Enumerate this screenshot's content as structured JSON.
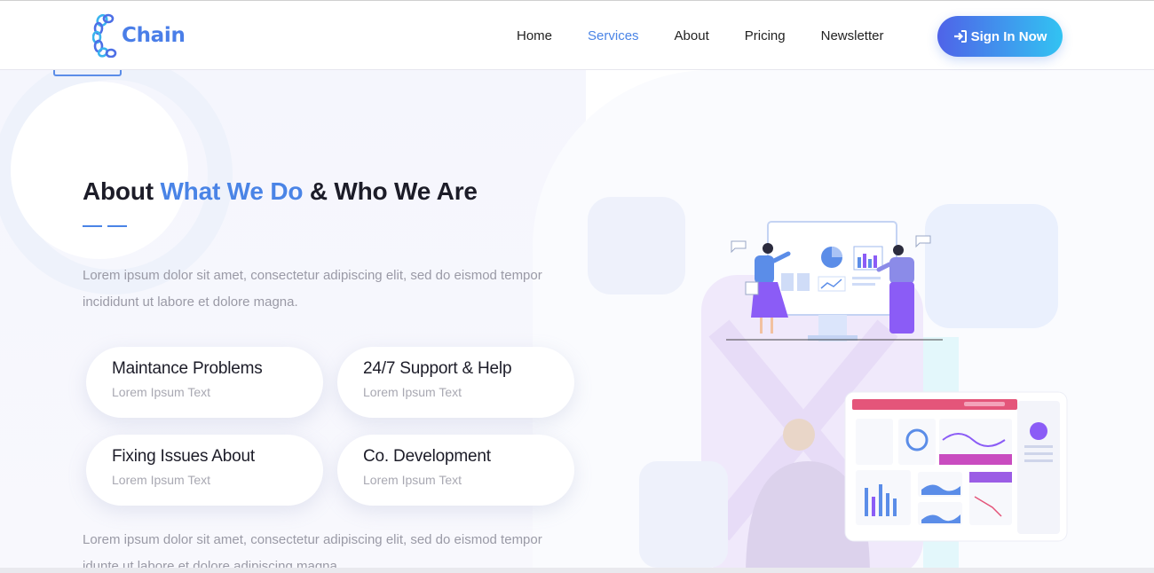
{
  "brand": {
    "name": "Chain",
    "accent": "#4a7ee8"
  },
  "nav": {
    "items": [
      {
        "label": "Home",
        "active": false
      },
      {
        "label": "Services",
        "active": true
      },
      {
        "label": "About",
        "active": false
      },
      {
        "label": "Pricing",
        "active": false
      },
      {
        "label": "Newsletter",
        "active": false
      }
    ],
    "signin_label": "Sign In Now",
    "signin_icon": "sign-in-icon"
  },
  "about": {
    "title_prefix": "About ",
    "title_accent": "What We Do",
    "title_suffix": " & Who We Are",
    "description": "Lorem ipsum dolor sit amet, consectetur adipiscing elit, sed do eismod tempor incididunt ut labore et dolore magna.",
    "features": [
      {
        "title": "Maintance Problems",
        "subtitle": "Lorem Ipsum Text"
      },
      {
        "title": "24/7 Support & Help",
        "subtitle": "Lorem Ipsum Text"
      },
      {
        "title": "Fixing Issues About",
        "subtitle": "Lorem Ipsum Text"
      },
      {
        "title": "Co. Development",
        "subtitle": "Lorem Ipsum Text"
      }
    ],
    "description2": "Lorem ipsum dolor sit amet, consectetur adipiscing elit, sed do eismod tempor idunte ut labore et dolore adipiscing magna."
  },
  "colors": {
    "primary": "#4a84e6",
    "gradient_start": "#4f63e8",
    "gradient_end": "#32c3f2",
    "purple": "#8b5cf6"
  }
}
